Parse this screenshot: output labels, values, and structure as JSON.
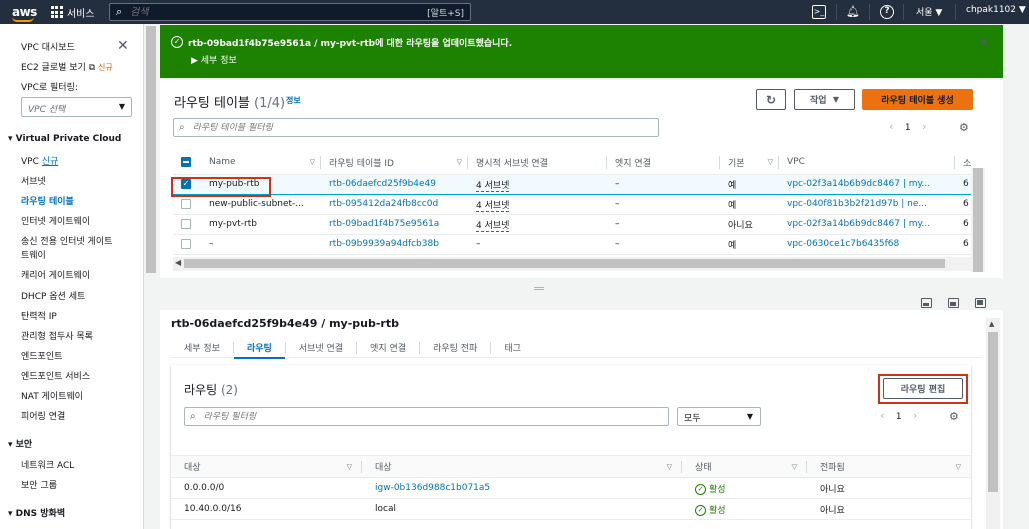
{
  "topnav": {
    "logo": "aws",
    "services": "서비스",
    "search_placeholder": "검색",
    "search_shortcut": "[알트+S]",
    "region": "서울 ▼",
    "user": "chpak1102 ▼"
  },
  "sidebar": {
    "items_top": [
      {
        "label": "VPC 대시보드"
      },
      {
        "label": "EC2 글로벌 보기",
        "badge": "신규"
      },
      {
        "label": "VPC로 필터링:"
      }
    ],
    "vpc_select_placeholder": "VPC 선택",
    "section1": "Virtual Private Cloud",
    "items1": [
      {
        "label": "VPC",
        "badge": "신규"
      },
      {
        "label": "서브넷"
      },
      {
        "label": "라우팅 테이블",
        "active": true
      },
      {
        "label": "인터넷 게이트웨이"
      },
      {
        "label": "송신 전용 인터넷 게이트",
        "cont": "트웨이"
      },
      {
        "label": "캐리어 게이트웨이"
      },
      {
        "label": "DHCP 옵션 세트"
      },
      {
        "label": "탄력적 IP"
      },
      {
        "label": "관리형 접두사 목록"
      },
      {
        "label": "엔드포인트"
      },
      {
        "label": "엔드포인트 서비스"
      },
      {
        "label": "NAT 게이트웨이"
      },
      {
        "label": "피어링 연결"
      }
    ],
    "section2": "보안",
    "items2": [
      {
        "label": "네트워크 ACL"
      },
      {
        "label": "보안 그룹"
      }
    ],
    "section3": "DNS 방화벽"
  },
  "banner": {
    "message": "rtb-09bad1f4b75e9561a / my-pvt-rtb에 대한 라우팅을 업데이트했습니다.",
    "details": "▶ 세부 정보"
  },
  "top": {
    "title": "라우팅 테이블",
    "count": "(1/4)",
    "info": "정보",
    "action_label": "작업",
    "create_label": "라우팅 테이블 생성",
    "filter_placeholder": "라우팅 테이블 필터링",
    "page": "1",
    "columns": [
      "Name",
      "라우팅 테이블 ID",
      "명시적 서브넷 연결",
      "엣지 연결",
      "기본",
      "VPC",
      "소"
    ],
    "rows": [
      {
        "checked": true,
        "name": "my-pub-rtb",
        "id": "rtb-06daefcd25f9b4e49",
        "subnet": "4 서브넷",
        "edge": "–",
        "main": "예",
        "vpc": "vpc-02f3a14b6b9dc8467 | my...",
        "owner": "6"
      },
      {
        "checked": false,
        "name": "new-public-subnet-...",
        "id": "rtb-095412da24fb8cc0d",
        "subnet": "4 서브넷",
        "edge": "–",
        "main": "예",
        "vpc": "vpc-040f81b3b2f21d97b | ne...",
        "owner": "6"
      },
      {
        "checked": false,
        "name": "my-pvt-rtb",
        "id": "rtb-09bad1f4b75e9561a",
        "subnet": "4 서브넷",
        "edge": "–",
        "main": "아니요",
        "vpc": "vpc-02f3a14b6b9dc8467 | my...",
        "owner": "6"
      },
      {
        "checked": false,
        "name": "–",
        "id": "rtb-09b9939a94dfcb38b",
        "subnet": "–",
        "edge": "–",
        "main": "예",
        "vpc": "vpc-0630ce1c7b6435f68",
        "owner": "6"
      }
    ]
  },
  "detail": {
    "title": "rtb-06daefcd25f9b4e49 / my-pub-rtb",
    "tabs": [
      "세부 정보",
      "라우팅",
      "서브넷 연결",
      "엣지 연결",
      "라우팅 전파",
      "태그"
    ],
    "routes_title": "라우팅",
    "routes_count": "(2)",
    "edit_label": "라우팅 편집",
    "filter_placeholder": "라우팅 필터링",
    "select_value": "모두",
    "page": "1",
    "columns": [
      "대상",
      "대상",
      "상태",
      "전파됨"
    ],
    "rows": [
      {
        "dest": "0.0.0.0/0",
        "target": "igw-0b136d988c1b071a5",
        "status": "활성",
        "prop": "아니요"
      },
      {
        "dest": "10.40.0.0/16",
        "target": "local",
        "status": "활성",
        "prop": "아니요"
      }
    ]
  }
}
